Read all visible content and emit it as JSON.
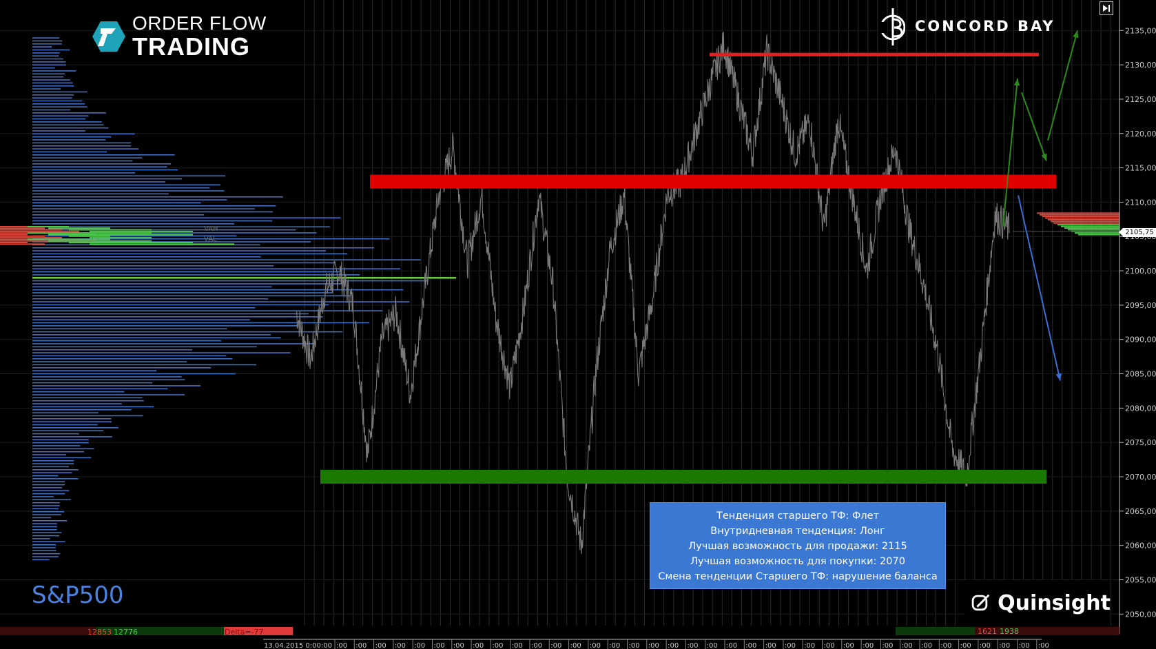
{
  "chart_data": {
    "type": "line",
    "instrument_label": "S&P500",
    "ylim": [
      2047,
      2140
    ],
    "y_ticks": [
      2050,
      2055,
      2060,
      2065,
      2070,
      2075,
      2080,
      2085,
      2090,
      2095,
      2100,
      2105,
      2110,
      2115,
      2120,
      2125,
      2130,
      2135
    ],
    "y_tick_labels": [
      "2050,00",
      "2055,00",
      "2060,00",
      "2065,00",
      "2070,00",
      "2075,00",
      "2080,00",
      "2085,00",
      "2090,00",
      "2095,00",
      "2100,00",
      "2105,00",
      "2110,00",
      "2115,00",
      "2120,00",
      "2125,00",
      "2130,00",
      "2135,00"
    ],
    "current_price": 2105.75,
    "current_price_label": "2105,75",
    "x_start_label": "13.04.2015 0:00:00",
    "x_tick_label": ":00",
    "price_path": [
      [
        0,
        2094
      ],
      [
        0.02,
        2087
      ],
      [
        0.04,
        2097
      ],
      [
        0.06,
        2100
      ],
      [
        0.08,
        2095
      ],
      [
        0.1,
        2073
      ],
      [
        0.12,
        2090
      ],
      [
        0.14,
        2094
      ],
      [
        0.16,
        2082
      ],
      [
        0.18,
        2097
      ],
      [
        0.2,
        2111
      ],
      [
        0.22,
        2118
      ],
      [
        0.24,
        2101
      ],
      [
        0.26,
        2111
      ],
      [
        0.28,
        2093
      ],
      [
        0.3,
        2083
      ],
      [
        0.32,
        2095
      ],
      [
        0.34,
        2111
      ],
      [
        0.36,
        2098
      ],
      [
        0.38,
        2070
      ],
      [
        0.4,
        2060
      ],
      [
        0.42,
        2085
      ],
      [
        0.44,
        2103
      ],
      [
        0.46,
        2111
      ],
      [
        0.48,
        2085
      ],
      [
        0.5,
        2096
      ],
      [
        0.52,
        2111
      ],
      [
        0.54,
        2113
      ],
      [
        0.56,
        2120
      ],
      [
        0.58,
        2127
      ],
      [
        0.6,
        2133
      ],
      [
        0.62,
        2125
      ],
      [
        0.64,
        2117
      ],
      [
        0.66,
        2132
      ],
      [
        0.68,
        2125
      ],
      [
        0.7,
        2117
      ],
      [
        0.72,
        2122
      ],
      [
        0.74,
        2106
      ],
      [
        0.76,
        2122
      ],
      [
        0.78,
        2111
      ],
      [
        0.8,
        2100
      ],
      [
        0.82,
        2111
      ],
      [
        0.84,
        2118
      ],
      [
        0.86,
        2106
      ],
      [
        0.88,
        2098
      ],
      [
        0.9,
        2088
      ],
      [
        0.92,
        2074
      ],
      [
        0.94,
        2070
      ],
      [
        0.96,
        2088
      ],
      [
        0.98,
        2108
      ],
      [
        1,
        2106
      ]
    ],
    "levels": [
      {
        "name": "resistance-upper",
        "price": 2131.5,
        "color": "#e32020"
      },
      {
        "name": "resistance-main",
        "price": 2113,
        "color": "#e00000"
      },
      {
        "name": "support-main",
        "price": 2070,
        "color": "#1a7a00"
      }
    ],
    "arrows": [
      {
        "name": "up-arrow-1",
        "color": "#2b8b1a"
      },
      {
        "name": "down-arrow-1",
        "color": "#2b8b1a"
      },
      {
        "name": "up-arrow-2",
        "color": "#2b8b1a"
      },
      {
        "name": "down-arrow-blue",
        "color": "#3a6fd8"
      }
    ],
    "volume_profile": {
      "vah_label": "VAH",
      "val_label": "VAL",
      "poc_price": 2099,
      "colors": {
        "bars": "#4472c4",
        "poc": "#6dd03b",
        "buy": "#4ec94e",
        "sell": "#d9473c"
      }
    },
    "footer": {
      "left_sell": "12853",
      "left_buy": "12776",
      "left_delta": "Delta=-77",
      "right_buy": "1621",
      "right_sell": "1938"
    }
  },
  "logos": {
    "ofm_line1": "ORDER FLOW",
    "ofm_line2": "TRADING",
    "concord": "CONCORD BAY",
    "quinsight": "Quinsight"
  },
  "info_box": {
    "line1": "Тенденция старшего ТФ: Флет",
    "line2": "Внутридневная тенденция: Лонг",
    "line3": "Лучшая возможность для продажи:  2115",
    "line4": "Лучшая возможность для покупки:  2070",
    "line5": "Смена тенденции Старшего ТФ:  нарушение баланса"
  },
  "colors": {
    "background": "#000000",
    "grid": "#2a2a2a",
    "price": "#7a7a7a",
    "accent_blue": "#3b78d4"
  }
}
